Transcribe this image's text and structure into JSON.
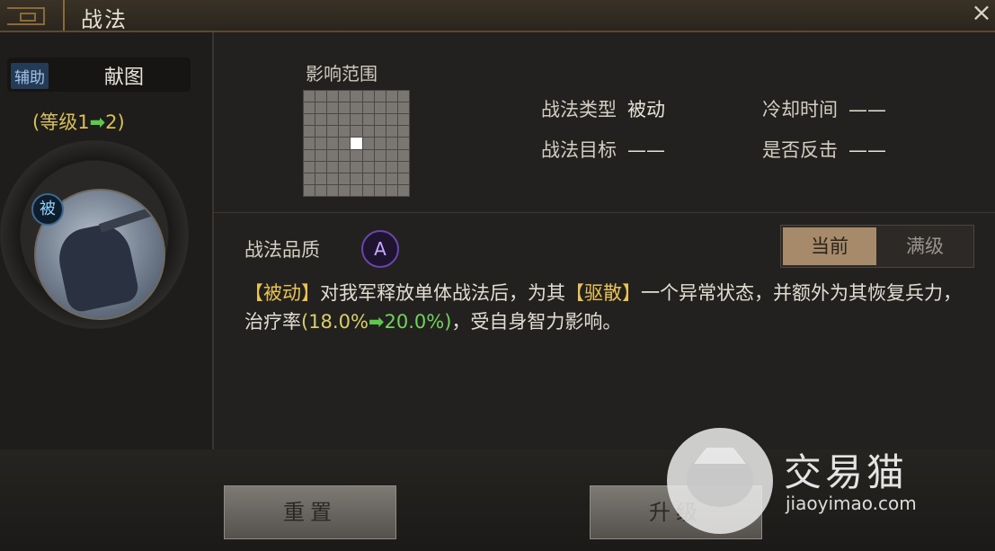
{
  "window": {
    "title": "战法",
    "close_icon": "×"
  },
  "left": {
    "tag_type": "辅助",
    "tag_source": "献图",
    "level_prefix": "(等级1",
    "level_arrow": "➡",
    "level_suffix": "2)",
    "passive_badge": "被"
  },
  "range": {
    "label": "影响范围",
    "grid_size": 9,
    "active_cell": [
      4,
      4
    ]
  },
  "stats": {
    "type_label": "战法类型",
    "type_value": "被动",
    "cooldown_label": "冷却时间",
    "cooldown_value": "——",
    "target_label": "战法目标",
    "target_value": "——",
    "counter_label": "是否反击",
    "counter_value": "——"
  },
  "quality": {
    "label": "战法品质",
    "grade": "A"
  },
  "toggle": {
    "current": "当前",
    "max": "满级"
  },
  "description": {
    "p1": "【被动】",
    "p2": "对我军释放单体战法后，为其",
    "p3": "【驱散】",
    "p4": "一个异常状态，并额外为其恢复兵力，治疗率",
    "p5": "(18.0%",
    "p6": "➡",
    "p7": "20.0%)",
    "p8": "，受自身智力影响。"
  },
  "buttons": {
    "reset": "重置",
    "upgrade": "升级"
  },
  "watermark": {
    "name": "交易猫",
    "url": "jiaoyimao.com"
  },
  "colors": {
    "accent_gold": "#e8c354",
    "accent_green": "#6fd45a",
    "quality_purple": "#6a46a8"
  }
}
